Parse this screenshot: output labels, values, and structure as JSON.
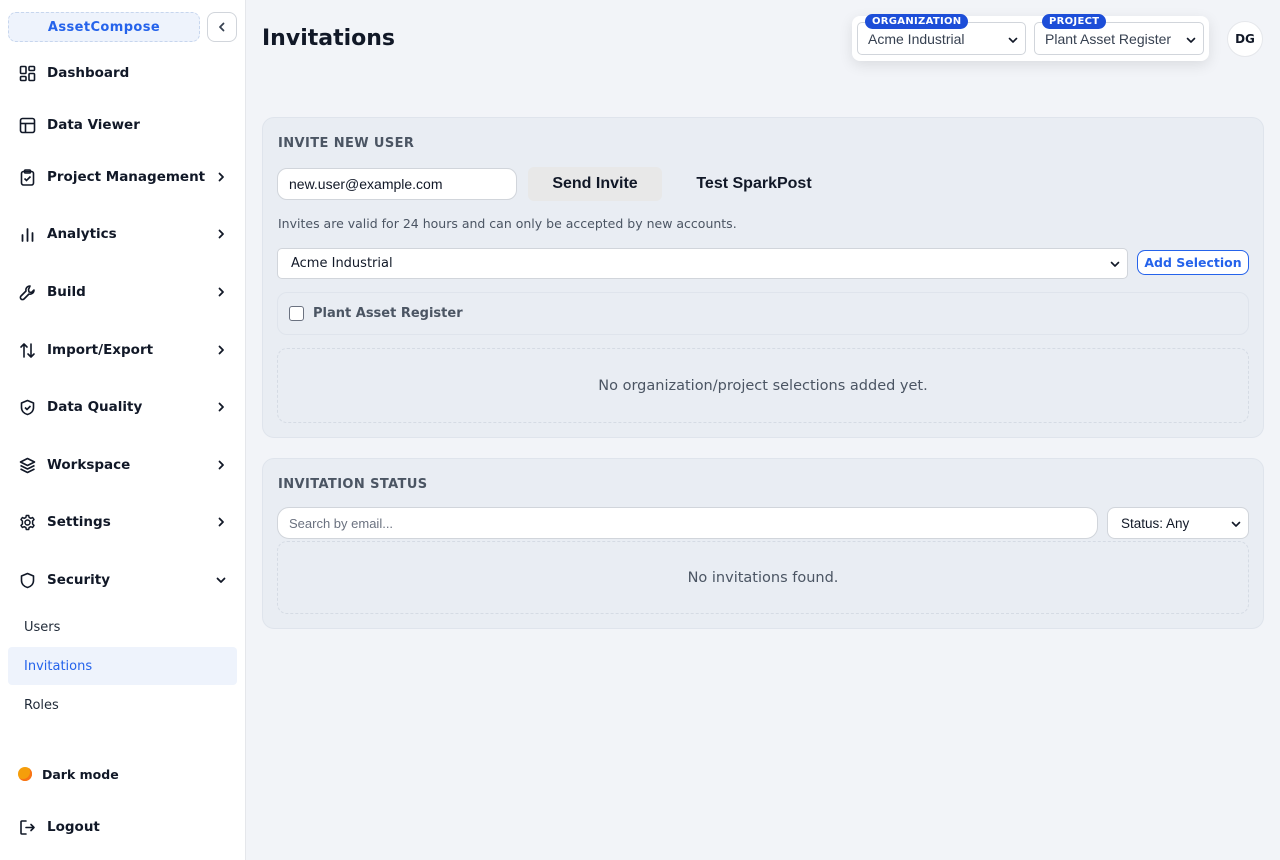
{
  "app": {
    "brand": "AssetCompose"
  },
  "sidebar": {
    "items": [
      {
        "label": "Dashboard",
        "icon": "dashboard-icon"
      },
      {
        "label": "Data Viewer",
        "icon": "table-icon"
      },
      {
        "label": "Project Management",
        "icon": "clipboard-icon"
      },
      {
        "label": "Analytics",
        "icon": "bar-chart-icon"
      },
      {
        "label": "Build",
        "icon": "wrench-icon"
      },
      {
        "label": "Import/Export",
        "icon": "arrows-updown-icon"
      },
      {
        "label": "Data Quality",
        "icon": "shield-check-icon"
      },
      {
        "label": "Workspace",
        "icon": "layers-icon"
      },
      {
        "label": "Settings",
        "icon": "gear-icon"
      },
      {
        "label": "Security",
        "icon": "shield-icon"
      }
    ],
    "security_sub": [
      "Users",
      "Invitations",
      "Roles"
    ],
    "active_sub": "Invitations",
    "dark_mode_label": "Dark mode",
    "logout_label": "Logout"
  },
  "header": {
    "title": "Invitations",
    "organization_tag": "ORGANIZATION",
    "organization_value": "Acme Industrial",
    "project_tag": "PROJECT",
    "project_value": "Plant Asset Register",
    "avatar_initials": "DG"
  },
  "invite": {
    "title": "INVITE NEW USER",
    "email_value": "new.user@example.com",
    "send_label": "Send Invite",
    "test_label": "Test SparkPost",
    "hint": "Invites are valid for 24 hours and can only be accepted by new accounts.",
    "org_select_value": "Acme Industrial",
    "add_selection_label": "Add Selection",
    "project_checkbox_label": "Plant Asset Register",
    "empty_text": "No organization/project selections added yet."
  },
  "status": {
    "title": "INVITATION STATUS",
    "search_placeholder": "Search by email...",
    "filter_value": "Status: Any",
    "empty_text": "No invitations found."
  },
  "colors": {
    "accent": "#2563eb",
    "tag": "#1d4ed8",
    "page_bg": "#f2f4f8",
    "card_bg": "#e9edf3"
  }
}
